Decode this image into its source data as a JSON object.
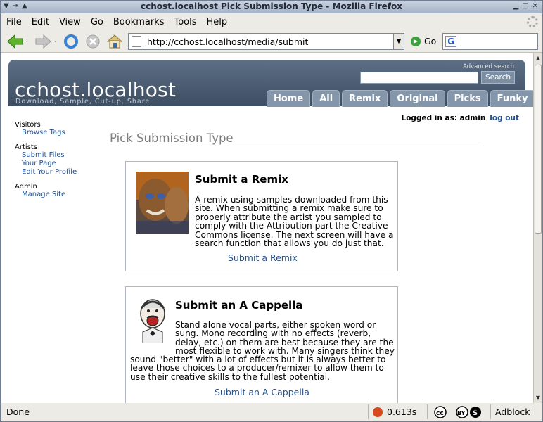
{
  "window": {
    "title": "cchost.localhost Pick Submission Type - Mozilla Firefox"
  },
  "menu": [
    "File",
    "Edit",
    "View",
    "Go",
    "Bookmarks",
    "Tools",
    "Help"
  ],
  "nav": {
    "url": "http://cchost.localhost/media/submit",
    "go_label": "Go",
    "search_engine_letter": "G"
  },
  "status": {
    "text": "Done",
    "time": "0.613s",
    "adblock": "Adblock"
  },
  "site": {
    "title": "cchost.localhost",
    "tagline": "Download, Sample, Cut-up, Share.",
    "advanced_search": "Advanced search",
    "search_button": "Search",
    "tabs": [
      "Home",
      "All",
      "Remix",
      "Original",
      "Picks",
      "Funky"
    ]
  },
  "login": {
    "text": "Logged in as: admin",
    "logout": "log out"
  },
  "sidebar": [
    {
      "heading": "Visitors",
      "links": [
        "Browse Tags"
      ]
    },
    {
      "heading": "Artists",
      "links": [
        "Submit Files",
        "Your Page",
        "Edit Your Profile"
      ]
    },
    {
      "heading": "Admin",
      "links": [
        "Manage Site"
      ]
    }
  ],
  "page": {
    "heading": "Pick Submission Type"
  },
  "cards": [
    {
      "heading": "Submit a Remix",
      "lines": [
        "A remix using samples downloaded from this",
        "site. When submitting a remix make sure to",
        "properly attribute the artist you sampled to",
        "comply with the Attribution part the Creative",
        "Commons license. The next screen will have a",
        "search function that allows you do just that."
      ],
      "link": "Submit a Remix"
    },
    {
      "heading": "Submit an A Cappella",
      "lines": [
        "Stand alone vocal parts, either spoken word or",
        "sung. Mono recording with no effects (reverb,",
        "delay, etc.) on them are best because they are the",
        "most flexible to work with. Many singers think they",
        "sound \"better\" with a lot of effects but it is always better to",
        "leave those choices to a producer/remixer to allow them to",
        "use their creative skills to the fullest potential."
      ],
      "link": "Submit an A Cappella"
    }
  ]
}
